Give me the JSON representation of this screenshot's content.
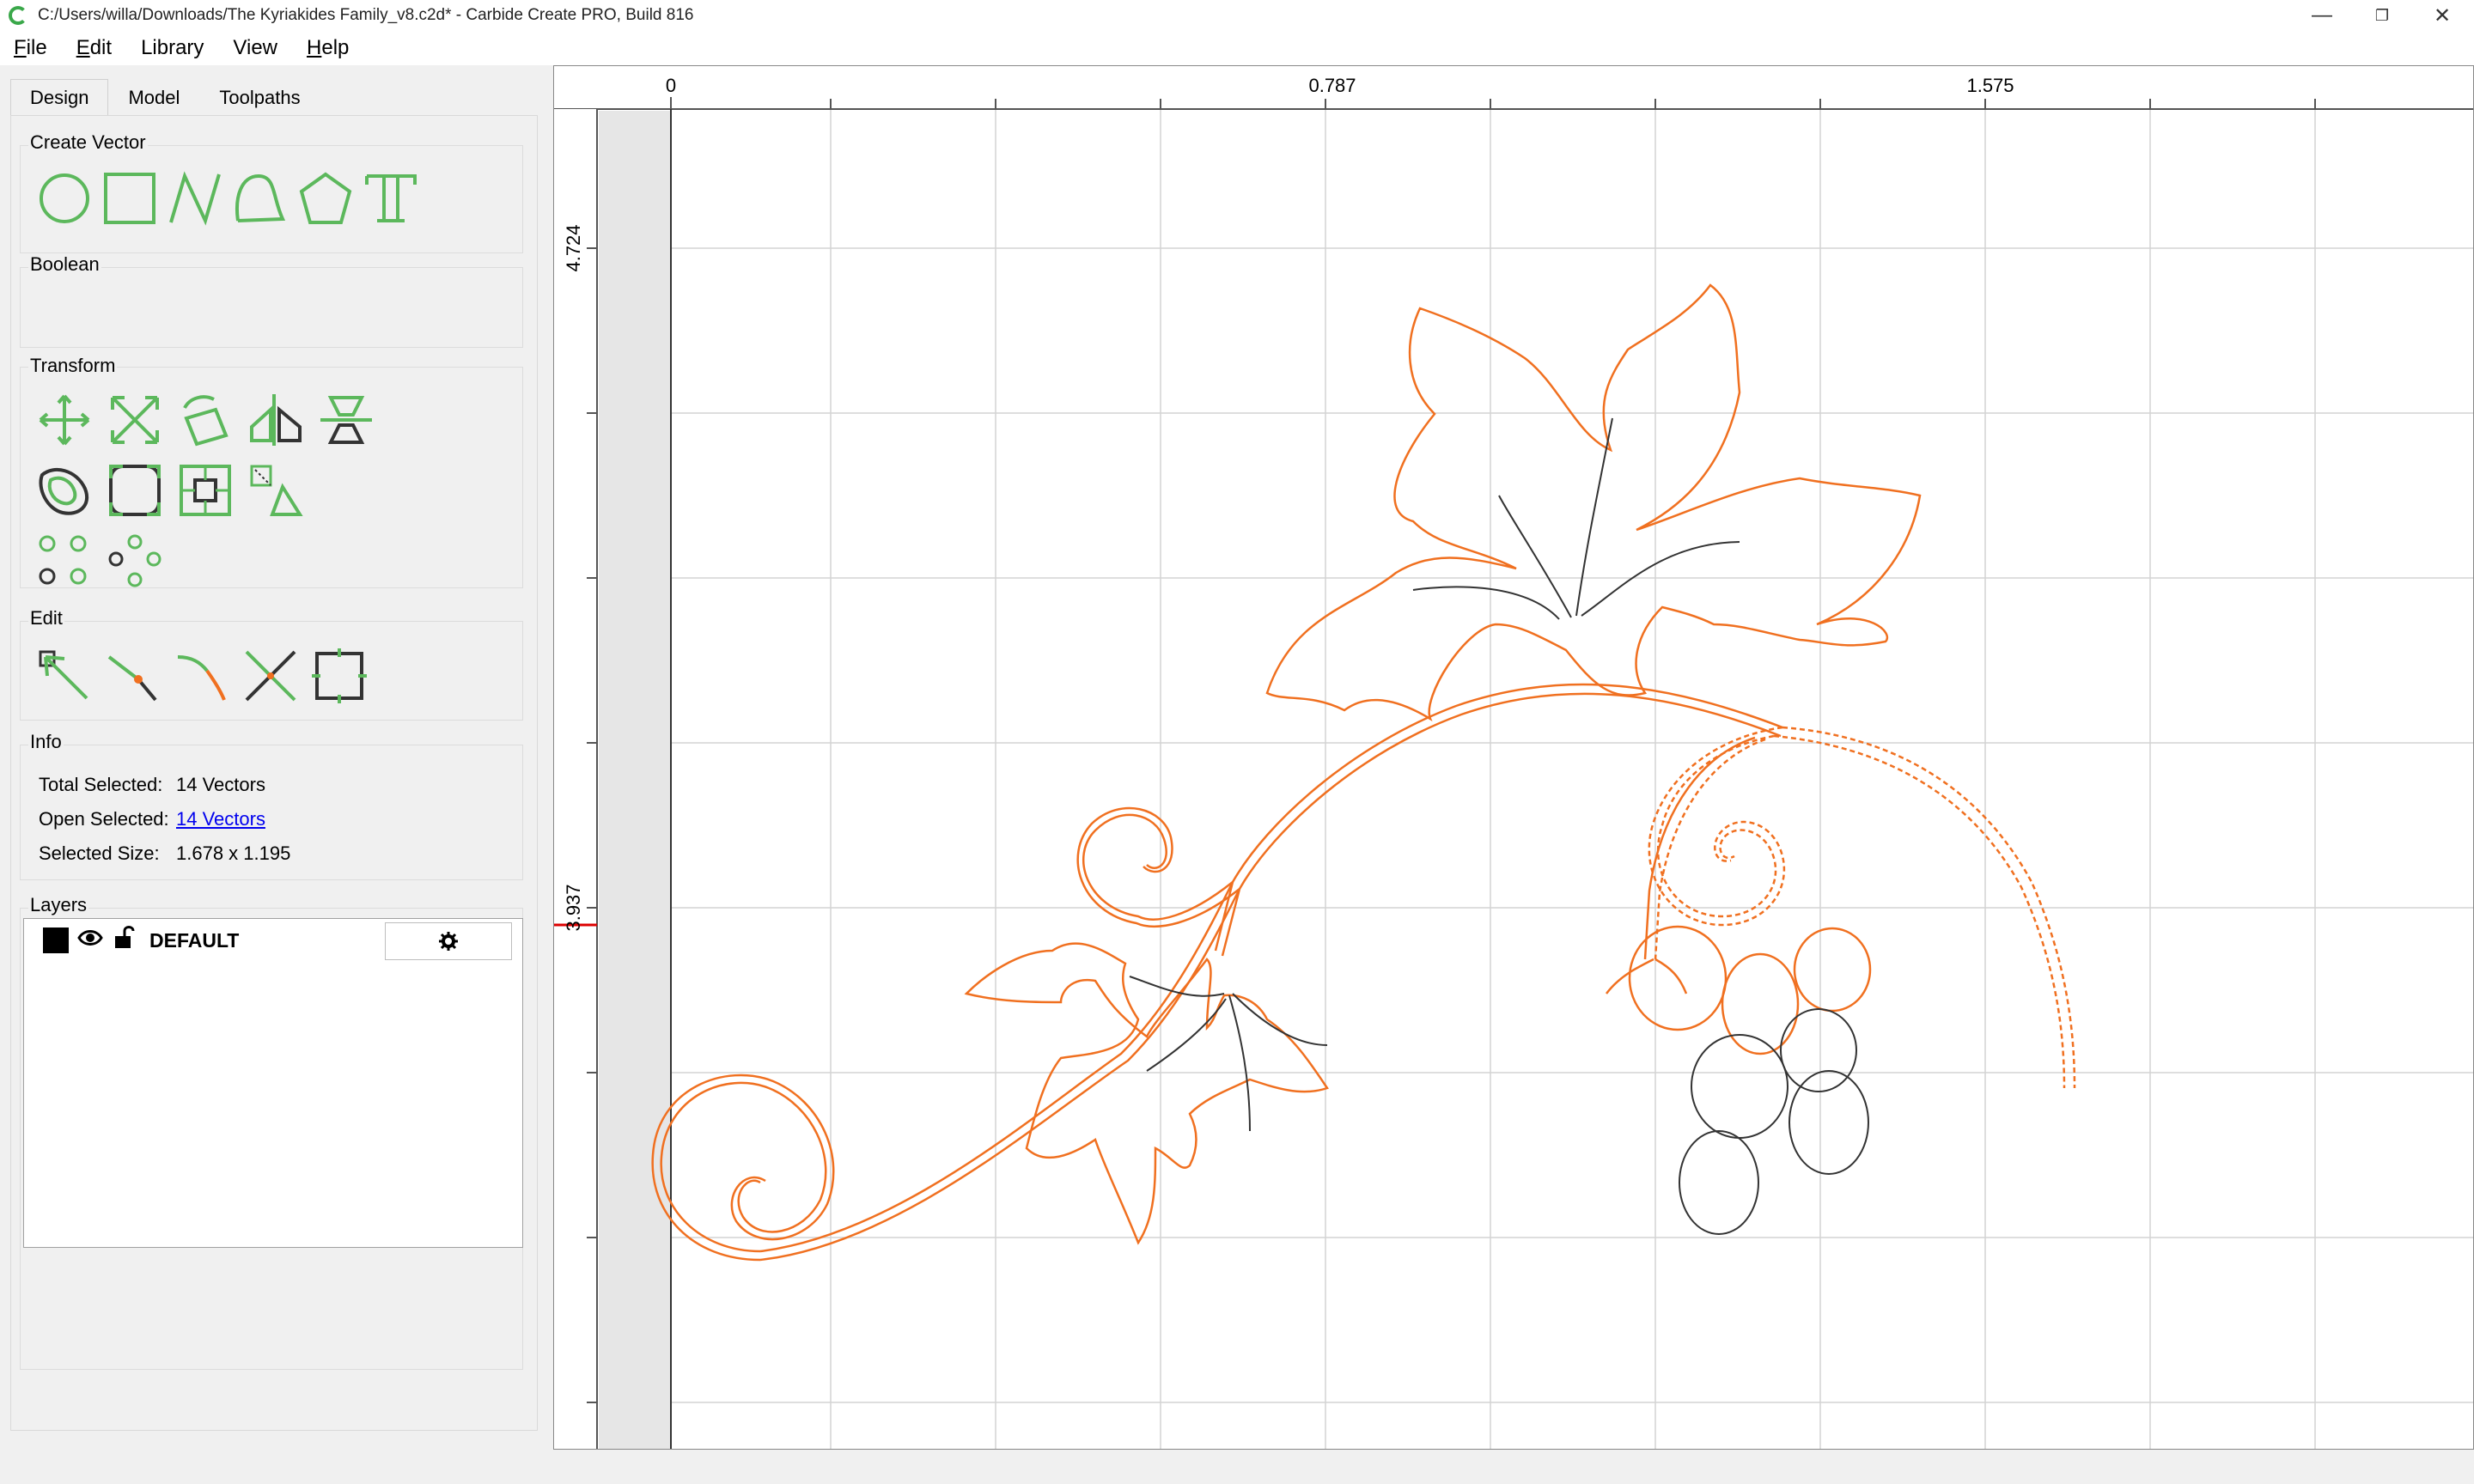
{
  "window": {
    "title": "C:/Users/willa/Downloads/The Kyriakides Family_v8.c2d* - Carbide Create PRO, Build 816",
    "controls": {
      "minimize": "—",
      "maximize": "❐",
      "close": "✕"
    }
  },
  "menu": {
    "items": [
      {
        "underline": "F",
        "rest": "ile"
      },
      {
        "underline": "E",
        "rest": "dit"
      },
      {
        "underline": "",
        "rest": "Library"
      },
      {
        "underline": "",
        "rest": "View"
      },
      {
        "underline": "H",
        "rest": "elp"
      }
    ]
  },
  "tabs": [
    "Design",
    "Model",
    "Toolpaths"
  ],
  "sections": {
    "create_vector": "Create Vector",
    "boolean": "Boolean",
    "transform": "Transform",
    "edit": "Edit",
    "info": "Info",
    "layers": "Layers"
  },
  "info": {
    "total_selected_label": "Total Selected:",
    "total_selected_value": "14 Vectors",
    "open_selected_label": "Open Selected:",
    "open_selected_value": "14 Vectors",
    "selected_size_label": "Selected Size:",
    "selected_size_value": "1.678 x 1.195"
  },
  "layers": [
    {
      "name": "DEFAULT",
      "color": "#000000"
    }
  ],
  "ruler": {
    "top_labels": [
      "0",
      "0.787",
      "1.575"
    ],
    "left_labels": [
      "4.724",
      "3.937"
    ]
  },
  "colors": {
    "accent_green": "#5cb85c",
    "vector_orange": "#f07020",
    "vector_dark": "#333333"
  }
}
